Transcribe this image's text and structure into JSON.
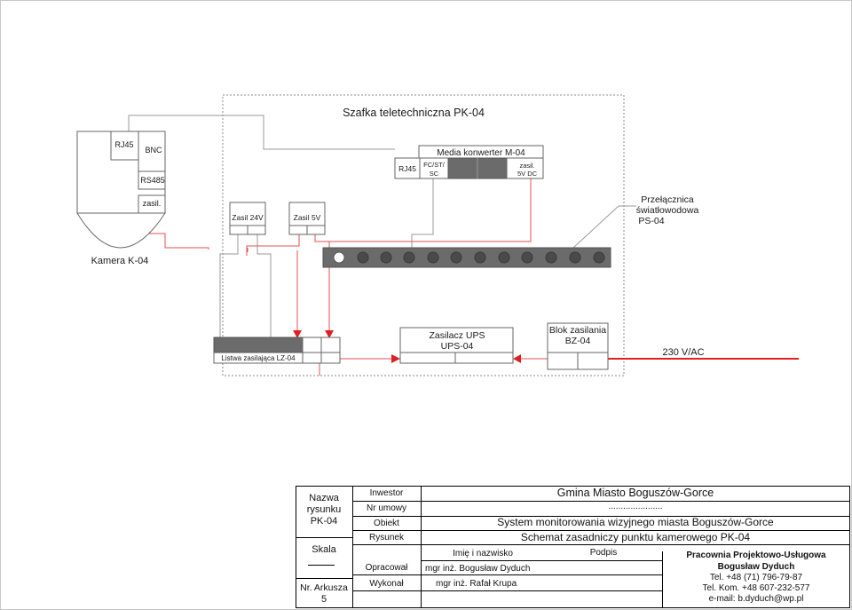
{
  "diagram": {
    "cabinet_title": "Szafka teletechniczna PK-04",
    "camera": {
      "rj45": "RJ45",
      "bnc": "BNC",
      "rs485": "RS485",
      "power": "zasil.",
      "label": "Kamera K-04"
    },
    "power_24v": "Zasil 24V",
    "power_5v": "Zasil 5V",
    "media_converter": {
      "title": "Media konwerter M-04",
      "rj45": "RJ45",
      "fiber_line1": "FC/ST/",
      "fiber_line2": "SC",
      "power_line1": "zasil.",
      "power_line2": "5V DC"
    },
    "switch_label": [
      "Przełącznica",
      "światłowodowa",
      "PS-04"
    ],
    "power_strip": "Listwa zasilająca LZ-04",
    "ups": [
      "Zasilacz UPS",
      "UPS-04"
    ],
    "power_block": [
      "Blok zasilania",
      "BZ-04"
    ],
    "mains": "230 V/AC"
  },
  "title_block": {
    "drawing_name_label": [
      "Nazwa",
      "rysunku"
    ],
    "drawing_name": "PK-04",
    "scale_label": "Skala",
    "sheet_label": "Nr. Arkusza",
    "sheet_number": "5",
    "investor_label": "Inwestor",
    "investor": "Gmina Miasto Boguszów-Gorce",
    "contract_label": "Nr umowy",
    "contract": "......................",
    "object_label": "Obiekt",
    "object": "System monitorowania wizyjnego miasta Boguszów-Gorce",
    "drawing_label": "Rysunek",
    "drawing": "Schemat zasadniczy punktu kamerowego PK-04",
    "name_header": "Imię i nazwisko",
    "signature_header": "Podpis",
    "prepared_label": "Opracował",
    "prepared_by": "mgr inż. Bogusław Dyduch",
    "executed_label": "Wykonał",
    "executed_by": "mgr inż. Rafał Krupa",
    "company": [
      "Pracownia Projektowo-Usługowa",
      "Bogusław Dyduch",
      "Tel. +48 (71) 796-79-87",
      "Tel. Kom. +48 607-232-577",
      "e-mail: b.dyduch@wp.pl"
    ]
  }
}
